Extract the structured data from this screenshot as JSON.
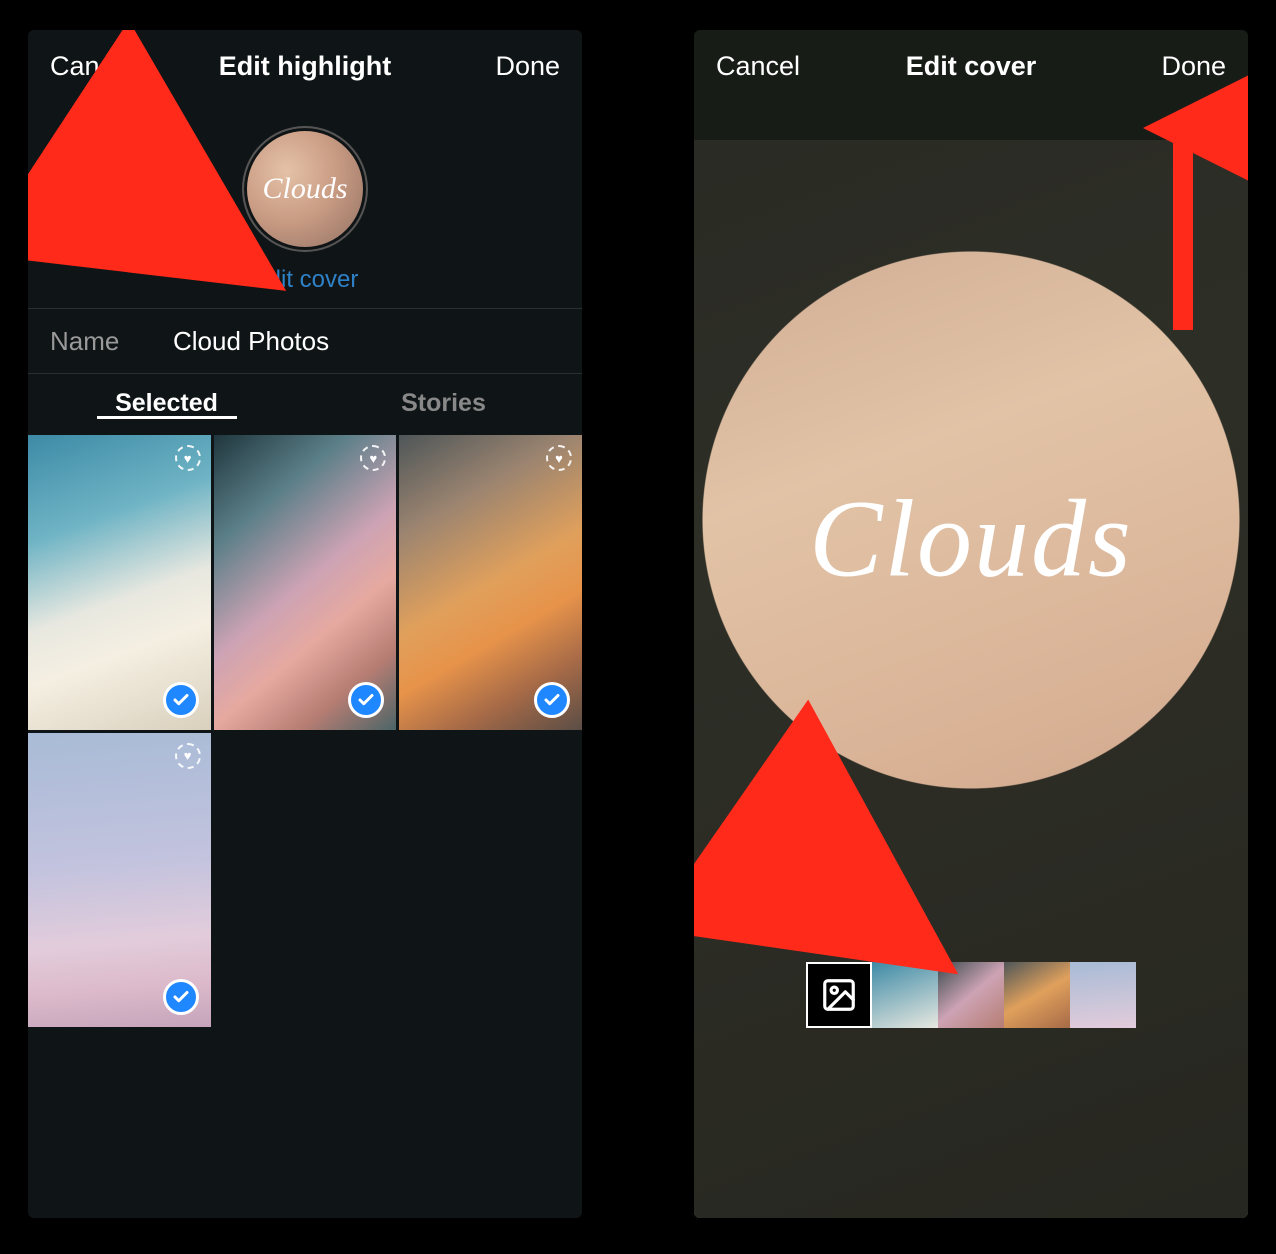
{
  "left": {
    "header": {
      "cancel": "Cancel",
      "title": "Edit highlight",
      "done": "Done"
    },
    "cover": {
      "label": "Clouds",
      "edit_cover_link": "Edit cover"
    },
    "name_row": {
      "label": "Name",
      "value": "Cloud Photos"
    },
    "tabs": {
      "selected": "Selected",
      "stories": "Stories",
      "active": "selected"
    },
    "photos": [
      {
        "id": "clouds1",
        "favorite_badge": true,
        "selected": true
      },
      {
        "id": "clouds2",
        "favorite_badge": true,
        "selected": true
      },
      {
        "id": "clouds3",
        "favorite_badge": true,
        "selected": true
      },
      {
        "id": "clouds4",
        "favorite_badge": true,
        "selected": true
      }
    ]
  },
  "right": {
    "header": {
      "cancel": "Cancel",
      "title": "Edit cover",
      "done": "Done"
    },
    "preview_label": "Clouds",
    "thumbnails": [
      {
        "kind": "gallery-icon"
      },
      {
        "kind": "photo",
        "id": "clouds1"
      },
      {
        "kind": "photo",
        "id": "clouds2"
      },
      {
        "kind": "photo",
        "id": "clouds3"
      },
      {
        "kind": "photo",
        "id": "clouds4"
      }
    ]
  },
  "annotations": {
    "arrow_to_edit_cover": true,
    "arrow_to_done_right": true,
    "arrow_to_gallery_thumbnail": true
  }
}
